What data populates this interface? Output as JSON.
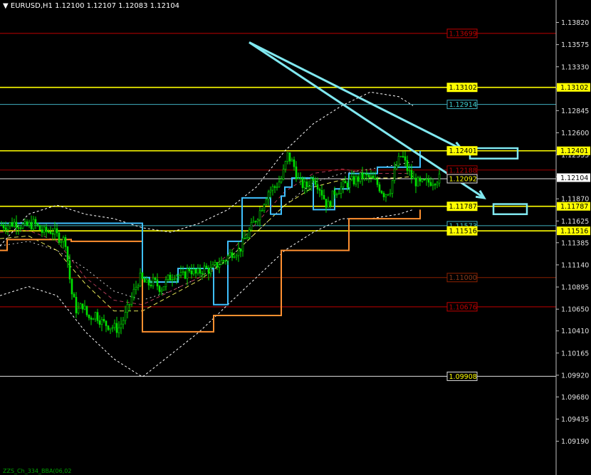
{
  "header": {
    "symbol": "EURUSD,H1",
    "ohlc": "1.12100 1.12107 1.12083 1.12104"
  },
  "footer_text": "ZZS_Ch_334_BBA(06,02",
  "chart_data": {
    "type": "candlestick",
    "ylim": [
      1.0899,
      1.1395
    ],
    "price_axis_ticks": [
      "1.13820",
      "1.13575",
      "1.13330",
      "1.13085",
      "1.12845",
      "1.12600",
      "1.12355",
      "1.12115",
      "1.11870",
      "1.11625",
      "1.11385",
      "1.11140",
      "1.10895",
      "1.10650",
      "1.10410",
      "1.10165",
      "1.09920",
      "1.09680",
      "1.09435",
      "1.09190"
    ],
    "current_price": "1.12104",
    "levels": [
      {
        "label": "1.13699",
        "value": 1.13699,
        "color": "#c00000",
        "label_bg": "#000",
        "label_fg": "#c00000",
        "right_tag": false
      },
      {
        "label": "1.13102",
        "value": 1.13102,
        "color": "#ffff00",
        "label_bg": "#ffff00",
        "label_fg": "#000",
        "right_tag": true
      },
      {
        "label": "1.12914",
        "value": 1.12914,
        "color": "#3fb0c0",
        "label_bg": "#000",
        "label_fg": "#3fd0d0",
        "right_tag": false
      },
      {
        "label": "1.12401",
        "value": 1.12401,
        "color": "#ffff00",
        "label_bg": "#ffff00",
        "label_fg": "#000",
        "right_tag": true
      },
      {
        "label": "1.12188",
        "value": 1.12188,
        "color": "#a00000",
        "label_bg": "#000",
        "label_fg": "#c00000",
        "right_tag": false
      },
      {
        "label": "1.12092",
        "value": 1.12092,
        "color": "#e0e0e0",
        "label_bg": "#000",
        "label_fg": "#ffff00",
        "right_tag": false
      },
      {
        "label": "1.11787",
        "value": 1.11787,
        "color": "#ffff00",
        "label_bg": "#ffff00",
        "label_fg": "#000",
        "right_tag": true
      },
      {
        "label": "1.11573",
        "value": 1.11573,
        "color": "#3fb0c0",
        "label_bg": "#000",
        "label_fg": "#3fd0d0",
        "right_tag": false
      },
      {
        "label": "1.11516",
        "value": 1.11516,
        "color": "#ffff00",
        "label_bg": "#ffff00",
        "label_fg": "#000",
        "right_tag": true
      },
      {
        "label": "1.11000",
        "value": 1.11,
        "color": "#8b2000",
        "label_bg": "#000",
        "label_fg": "#8b3a1a",
        "right_tag": false
      },
      {
        "label": "1.10676",
        "value": 1.10676,
        "color": "#c00000",
        "label_bg": "#000",
        "label_fg": "#c00000",
        "right_tag": false
      },
      {
        "label": "1.09908",
        "value": 1.09908,
        "color": "#e0e0e0",
        "label_bg": "#000",
        "label_fg": "#ffff00",
        "right_tag": false
      }
    ],
    "close_path": [
      [
        0,
        1.1158
      ],
      [
        10,
        1.1158
      ],
      [
        22,
        1.1161
      ],
      [
        35,
        1.1156
      ],
      [
        48,
        1.116
      ],
      [
        60,
        1.115
      ],
      [
        72,
        1.1152
      ],
      [
        82,
        1.1145
      ],
      [
        92,
        1.114
      ],
      [
        100,
        1.1085
      ],
      [
        108,
        1.1062
      ],
      [
        116,
        1.107
      ],
      [
        124,
        1.1055
      ],
      [
        134,
        1.106
      ],
      [
        144,
        1.105
      ],
      [
        156,
        1.1046
      ],
      [
        166,
        1.1043
      ],
      [
        176,
        1.1058
      ],
      [
        186,
        1.108
      ],
      [
        196,
        1.11
      ],
      [
        206,
        1.1092
      ],
      [
        216,
        1.1095
      ],
      [
        226,
        1.1088
      ],
      [
        236,
        1.1098
      ],
      [
        246,
        1.1105
      ],
      [
        256,
        1.11
      ],
      [
        266,
        1.111
      ],
      [
        276,
        1.1103
      ],
      [
        286,
        1.111
      ],
      [
        296,
        1.1108
      ],
      [
        306,
        1.1115
      ],
      [
        316,
        1.112
      ],
      [
        326,
        1.1128
      ],
      [
        336,
        1.113
      ],
      [
        346,
        1.1145
      ],
      [
        356,
        1.116
      ],
      [
        366,
        1.1175
      ],
      [
        376,
        1.1195
      ],
      [
        386,
        1.12
      ],
      [
        396,
        1.121
      ],
      [
        404,
        1.1235
      ],
      [
        412,
        1.1225
      ],
      [
        420,
        1.1205
      ],
      [
        430,
        1.12
      ],
      [
        440,
        1.1212
      ],
      [
        450,
        1.1198
      ],
      [
        460,
        1.1178
      ],
      [
        470,
        1.1195
      ],
      [
        480,
        1.12
      ],
      [
        490,
        1.1205
      ],
      [
        500,
        1.1208
      ],
      [
        510,
        1.1212
      ],
      [
        520,
        1.121
      ],
      [
        530,
        1.1203
      ],
      [
        540,
        1.1192
      ],
      [
        548,
        1.1198
      ],
      [
        556,
        1.1222
      ],
      [
        564,
        1.1236
      ],
      [
        572,
        1.122
      ],
      [
        580,
        1.1208
      ],
      [
        590,
        1.1203
      ],
      [
        600,
        1.1205
      ],
      [
        610,
        1.1208
      ],
      [
        618,
        1.121
      ]
    ],
    "indicators": {
      "zigzag_blue": [
        [
          0,
          1.116
        ],
        [
          30,
          1.116
        ],
        [
          30,
          1.116
        ],
        [
          200,
          1.116
        ],
        [
          200,
          1.11
        ],
        [
          210,
          1.11
        ],
        [
          210,
          1.1095
        ],
        [
          250,
          1.1095
        ],
        [
          250,
          1.111
        ],
        [
          300,
          1.111
        ],
        [
          300,
          1.107
        ],
        [
          320,
          1.107
        ],
        [
          320,
          1.114
        ],
        [
          340,
          1.114
        ],
        [
          340,
          1.1188
        ],
        [
          380,
          1.1188
        ],
        [
          380,
          1.117
        ],
        [
          395,
          1.117
        ],
        [
          395,
          1.119
        ],
        [
          400,
          1.119
        ],
        [
          400,
          1.12
        ],
        [
          410,
          1.12
        ],
        [
          410,
          1.121
        ],
        [
          440,
          1.121
        ],
        [
          440,
          1.1175
        ],
        [
          470,
          1.1175
        ],
        [
          470,
          1.1198
        ],
        [
          490,
          1.1198
        ],
        [
          490,
          1.1215
        ],
        [
          530,
          1.1215
        ],
        [
          530,
          1.1222
        ],
        [
          590,
          1.1222
        ],
        [
          590,
          1.124
        ]
      ],
      "zigzag_orange": [
        [
          0,
          1.113
        ],
        [
          10,
          1.113
        ],
        [
          10,
          1.1142
        ],
        [
          100,
          1.1142
        ],
        [
          100,
          1.114
        ],
        [
          200,
          1.114
        ],
        [
          200,
          1.104
        ],
        [
          300,
          1.104
        ],
        [
          300,
          1.1058
        ],
        [
          395,
          1.1058
        ],
        [
          395,
          1.113
        ],
        [
          490,
          1.113
        ],
        [
          490,
          1.1165
        ],
        [
          590,
          1.1165
        ],
        [
          590,
          1.1175
        ]
      ],
      "bb_upper": [
        [
          0,
          1.1135
        ],
        [
          40,
          1.117
        ],
        [
          80,
          1.118
        ],
        [
          120,
          1.117
        ],
        [
          160,
          1.1165
        ],
        [
          200,
          1.1155
        ],
        [
          240,
          1.115
        ],
        [
          280,
          1.116
        ],
        [
          320,
          1.1175
        ],
        [
          360,
          1.12
        ],
        [
          400,
          1.124
        ],
        [
          440,
          1.127
        ],
        [
          480,
          1.129
        ],
        [
          520,
          1.1305
        ],
        [
          560,
          1.13
        ],
        [
          580,
          1.129
        ]
      ],
      "bb_lower": [
        [
          0,
          1.108
        ],
        [
          40,
          1.109
        ],
        [
          80,
          1.108
        ],
        [
          120,
          1.104
        ],
        [
          160,
          1.101
        ],
        [
          200,
          1.099
        ],
        [
          240,
          1.1015
        ],
        [
          280,
          1.104
        ],
        [
          320,
          1.107
        ],
        [
          360,
          1.11
        ],
        [
          400,
          1.113
        ],
        [
          440,
          1.115
        ],
        [
          480,
          1.1165
        ],
        [
          520,
          1.1165
        ],
        [
          560,
          1.117
        ],
        [
          580,
          1.1175
        ]
      ],
      "bb_mid": [
        [
          0,
          1.1135
        ],
        [
          40,
          1.114
        ],
        [
          80,
          1.113
        ],
        [
          120,
          1.111
        ],
        [
          160,
          1.1085
        ],
        [
          200,
          1.1075
        ],
        [
          240,
          1.1085
        ],
        [
          280,
          1.11
        ],
        [
          320,
          1.112
        ],
        [
          360,
          1.115
        ],
        [
          400,
          1.118
        ],
        [
          440,
          1.1205
        ],
        [
          480,
          1.1215
        ],
        [
          520,
          1.122
        ],
        [
          560,
          1.1225
        ],
        [
          580,
          1.1228
        ]
      ],
      "ma_red": [
        [
          0,
          1.115
        ],
        [
          40,
          1.1152
        ],
        [
          80,
          1.114
        ],
        [
          120,
          1.11
        ],
        [
          160,
          1.1075
        ],
        [
          200,
          1.107
        ],
        [
          240,
          1.1085
        ],
        [
          280,
          1.11
        ],
        [
          320,
          1.1125
        ],
        [
          360,
          1.116
        ],
        [
          400,
          1.1195
        ],
        [
          440,
          1.1215
        ],
        [
          480,
          1.122
        ],
        [
          520,
          1.1215
        ],
        [
          560,
          1.1215
        ],
        [
          580,
          1.1215
        ]
      ],
      "ma_yellow": [
        [
          0,
          1.1143
        ],
        [
          40,
          1.1146
        ],
        [
          80,
          1.113
        ],
        [
          120,
          1.1093
        ],
        [
          160,
          1.1063
        ],
        [
          200,
          1.1063
        ],
        [
          240,
          1.108
        ],
        [
          280,
          1.1097
        ],
        [
          320,
          1.112
        ],
        [
          360,
          1.115
        ],
        [
          400,
          1.118
        ],
        [
          440,
          1.12
        ],
        [
          480,
          1.1208
        ],
        [
          520,
          1.121
        ],
        [
          560,
          1.121
        ],
        [
          580,
          1.1212
        ]
      ]
    },
    "annotations": {
      "arrow_lines": [
        {
          "from": [
            350,
            1.136
          ],
          "to": [
            648,
            1.1242
          ]
        },
        {
          "from": [
            350,
            1.136
          ],
          "to": [
            680,
            1.1188
          ]
        }
      ],
      "boxes": [
        {
          "x1": 660,
          "x2": 727,
          "y1": 1.1243,
          "y2": 1.12315
        },
        {
          "x1": 693,
          "x2": 740,
          "y1": 1.11812,
          "y2": 1.117
        }
      ]
    }
  }
}
